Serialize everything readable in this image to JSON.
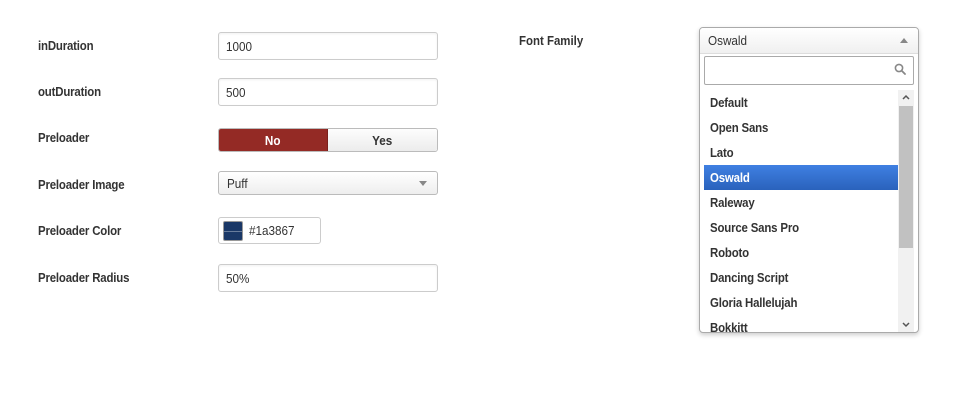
{
  "form": {
    "in_duration": {
      "label": "inDuration",
      "value": "1000"
    },
    "out_duration": {
      "label": "outDuration",
      "value": "500"
    },
    "preloader": {
      "label": "Preloader",
      "options": [
        "No",
        "Yes"
      ],
      "selected": "No"
    },
    "preloader_image": {
      "label": "Preloader Image",
      "value": "Puff"
    },
    "preloader_color": {
      "label": "Preloader Color",
      "value": "#1a3867"
    },
    "preloader_radius": {
      "label": "Preloader Radius",
      "value": "50%"
    }
  },
  "font_family": {
    "label": "Font Family",
    "selected": "Oswald",
    "search_value": "",
    "options": [
      "Default",
      "Open Sans",
      "Lato",
      "Oswald",
      "Raleway",
      "Source Sans Pro",
      "Roboto",
      "Dancing Script",
      "Gloria Hallelujah",
      "Bokkitt"
    ],
    "selected_index": 3
  },
  "colors": {
    "toggle_active": "#942a25",
    "swatch": "#1a3867",
    "highlight": "#3875d7"
  },
  "icons": {
    "search": "search-icon",
    "caret_down": "chevron-down-icon",
    "caret_up": "chevron-up-icon"
  }
}
